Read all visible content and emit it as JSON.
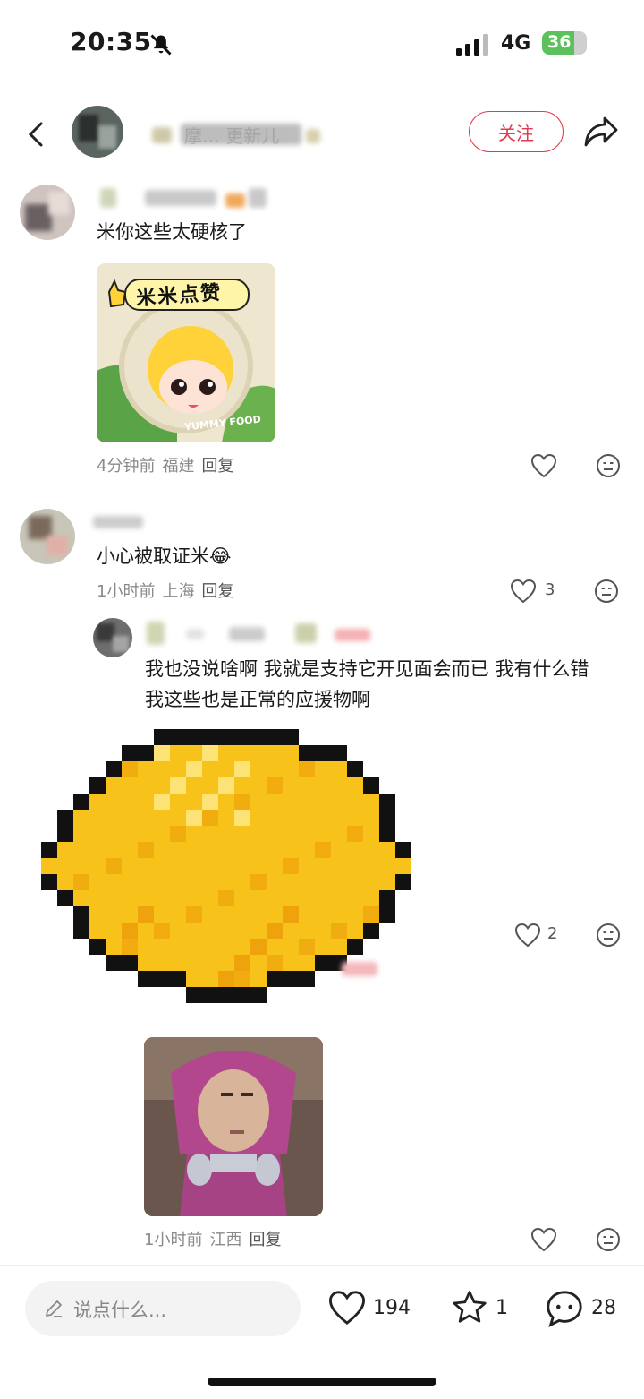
{
  "status_bar": {
    "time": "20:35",
    "network": "4G",
    "battery": "36"
  },
  "header": {
    "follow_label": "关注",
    "title_text": "摩… 更新儿"
  },
  "comments": [
    {
      "text": "米你这些太硬核了",
      "sticker_words": [
        "米米点赞",
        "YUMMY FOOD"
      ],
      "time": "4分钟前",
      "location": "福建",
      "reply": "回复"
    },
    {
      "text": "小心被取证米😂",
      "time": "1小时前",
      "location": "上海",
      "reply": "回复",
      "likes": "3"
    },
    {
      "text": "我也没说啥啊 我就是支持它开见面会而已 我有什么错 我这些也是正常的应援物啊",
      "likes": "2"
    },
    {
      "time": "1小时前",
      "location": "江西",
      "reply": "回复"
    }
  ],
  "bottom_bar": {
    "input_placeholder": "说点什么...",
    "likes": "194",
    "stars": "1",
    "comments": "28"
  }
}
